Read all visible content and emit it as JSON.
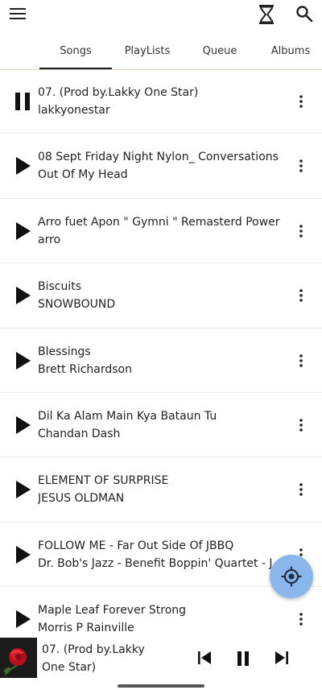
{
  "topbar": {
    "menu_icon": "menu-icon",
    "timer_icon": "hourglass-icon",
    "search_icon": "search-icon"
  },
  "tabs": [
    {
      "label": "Songs",
      "selected": true
    },
    {
      "label": "PlayLists",
      "selected": false
    },
    {
      "label": "Queue",
      "selected": false
    },
    {
      "label": "Albums",
      "selected": false
    }
  ],
  "songs": [
    {
      "title": "07.  (Prod by.Lakky One Star)",
      "artist": "lakkyonestar",
      "state": "playing"
    },
    {
      "title": "08 Sept Friday Night Nylon_ Conversations",
      "artist": "Out Of My Head",
      "state": "paused"
    },
    {
      "title": "Arro fuet Apon \" Gymni \" Remasterd Power",
      "artist": "arro",
      "state": "paused"
    },
    {
      "title": "Biscuits",
      "artist": "SNOWBOUND",
      "state": "paused"
    },
    {
      "title": "Blessings",
      "artist": "Brett Richardson",
      "state": "paused"
    },
    {
      "title": "Dil Ka Alam Main Kya Bataun Tu",
      "artist": "Chandan Dash",
      "state": "paused"
    },
    {
      "title": "ELEMENT OF SURPRISE",
      "artist": "JESUS OLDMAN",
      "state": "paused"
    },
    {
      "title": "FOLLOW ME - Far Out Side Of JBBQ",
      "artist": "Dr. Bob's Jazz - Benefit Boppin' Quartet - J",
      "state": "paused"
    },
    {
      "title": "Maple Leaf Forever Strong",
      "artist": "Morris P Rainville",
      "state": "paused"
    }
  ],
  "now_playing": {
    "title": "07.  (Prod by.Lakky One Star)",
    "art_icon": "rose-album-art"
  },
  "colors": {
    "fab": "#8ab6ec",
    "tab_underline": "#e4d2c0"
  }
}
